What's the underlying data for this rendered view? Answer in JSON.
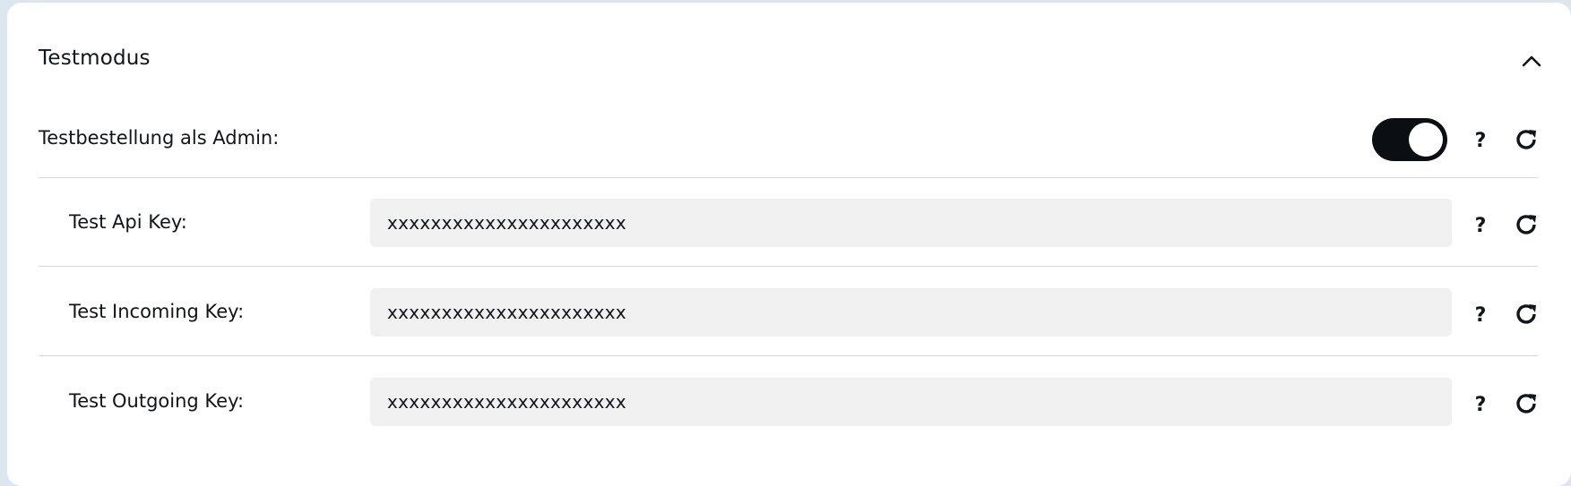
{
  "section": {
    "title": "Testmodus",
    "collapse_icon": "chevron-up-icon"
  },
  "admin_order": {
    "label": "Testbestellung als Admin:",
    "toggle_state": "on",
    "help_label": "?",
    "reset_icon": "reset-icon"
  },
  "fields": [
    {
      "label": "Test Api Key:",
      "value": "xxxxxxxxxxxxxxxxxxxxxx",
      "help_label": "?"
    },
    {
      "label": "Test Incoming Key:",
      "value": "xxxxxxxxxxxxxxxxxxxxxx",
      "help_label": "?"
    },
    {
      "label": "Test Outgoing Key:",
      "value": "xxxxxxxxxxxxxxxxxxxxxx",
      "help_label": "?"
    }
  ],
  "colors": {
    "page_background": "#dbe6ee",
    "card_background": "#ffffff",
    "toggle_on": "#0b0f14",
    "input_background": "#f0f0f0",
    "divider": "#d6d6d6",
    "text": "#111418"
  }
}
